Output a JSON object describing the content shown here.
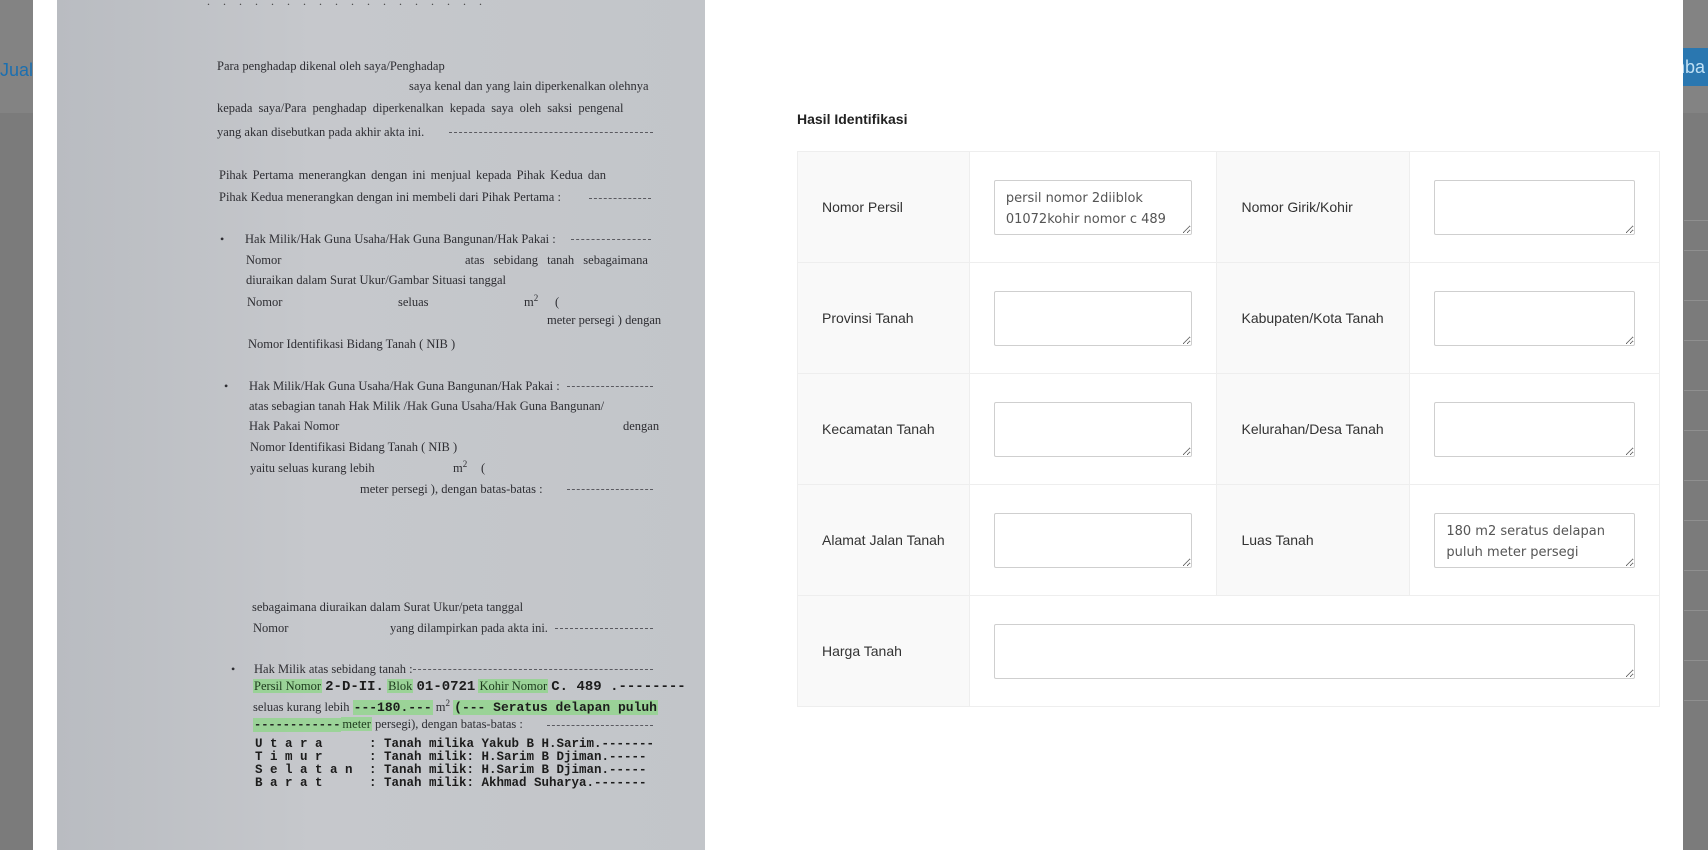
{
  "background": {
    "left_link_text": "Jual",
    "right_button_text": "mba"
  },
  "document": {
    "lines": [
      "Para penghadap dikenal oleh saya/Penghadap",
      "saya kenal dan yang lain diperkenalkan olehnya",
      "kepada saya/Para penghadap diperkenalkan kepada saya oleh saksi pengenal",
      "yang akan disebutkan pada akhir akta ini.",
      "Pihak Pertama menerangkan dengan ini menjual kepada Pihak Kedua dan",
      "Pihak Kedua menerangkan dengan ini membeli dari Pihak Pertama :",
      "Hak Milik/Hak Guna Usaha/Hak Guna Bangunan/Hak Pakai :",
      "Nomor",
      "atas sebidang tanah sebagaimana",
      "diuraikan dalam Surat Ukur/Gambar Situasi tanggal",
      "Nomor",
      "seluas",
      "m",
      "(",
      "meter persegi ) dengan",
      "Nomor Identifikasi Bidang Tanah ( NIB )",
      "Hak Milik/Hak Guna Usaha/Hak Guna Bangunan/Hak Pakai :",
      "atas sebagian tanah Hak Milik /Hak Guna Usaha/Hak Guna Bangunan/",
      "Hak Pakai Nomor",
      "dengan",
      "Nomor Identifikasi Bidang Tanah ( NIB )",
      "yaitu seluas kurang lebih",
      "m",
      "(",
      "meter persegi ), dengan batas-batas :",
      "sebagaimana diuraikan dalam Surat Ukur/peta tanggal",
      "Nomor",
      "yang dilampirkan pada akta ini.",
      "Hak Milik atas sebidang tanah :"
    ],
    "typed": {
      "persil_label": "Persil Nomor",
      "persil_value": "2-D-II.",
      "blok_label": "Blok",
      "blok_value": "01-0721",
      "kohir_label": "Kohir Nomor",
      "kohir_value": "C. 489 .--------",
      "seluas_label": "seluas kurang lebih",
      "seluas_value": "---180.---",
      "seluas_unit": "m",
      "seluas_words": "(--- Seratus delapan puluh",
      "meter_dashes": "------------",
      "meter_label": "meter",
      "meter_rest": "persegi), dengan batas-batas :",
      "boundaries": [
        {
          "dir": "U t a r a",
          "text": ": Tanah milika Yakub B H.Sarim.-------"
        },
        {
          "dir": "T i m u r",
          "text": ": Tanah milik: H.Sarim B Djiman.-----"
        },
        {
          "dir": "S e l a t a n",
          "text": ": Tanah milik: H.Sarim B Djiman.-----"
        },
        {
          "dir": "B a r a t",
          "text": ": Tanah milik: Akhmad Suharya.-------"
        }
      ]
    }
  },
  "form": {
    "title": "Hasil Identifikasi",
    "fields": {
      "nomor_persil": {
        "label": "Nomor Persil",
        "value": "persil nomor 2diiblok 01072kohir nomor c 489"
      },
      "nomor_girik": {
        "label": "Nomor Girik/Kohir",
        "value": ""
      },
      "provinsi": {
        "label": "Provinsi Tanah",
        "value": ""
      },
      "kabupaten": {
        "label": "Kabupaten/Kota Tanah",
        "value": ""
      },
      "kecamatan": {
        "label": "Kecamatan Tanah",
        "value": ""
      },
      "kelurahan": {
        "label": "Kelurahan/Desa Tanah",
        "value": ""
      },
      "alamat": {
        "label": "Alamat Jalan Tanah",
        "value": ""
      },
      "luas": {
        "label": "Luas Tanah",
        "value": "180 m2 seratus delapan puluh meter persegi"
      },
      "harga": {
        "label": "Harga Tanah",
        "value": ""
      }
    }
  }
}
